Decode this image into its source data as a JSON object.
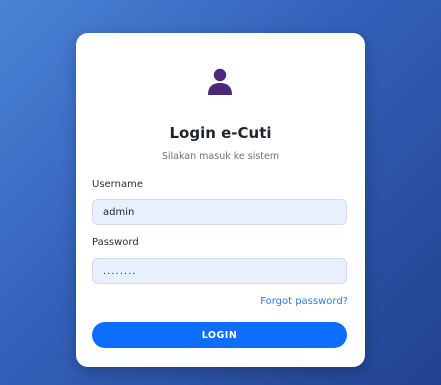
{
  "login": {
    "title": "Login e-Cuti",
    "subtitle": "Silakan masuk ke sistem",
    "username_label": "Username",
    "username_value": "admin",
    "password_label": "Password",
    "password_value": "........",
    "forgot_label": "Forgot password?",
    "button_label": "LOGIN"
  },
  "icons": {
    "avatar": "user-icon"
  },
  "colors": {
    "accent": "#0d6efd",
    "link": "#2f7de1",
    "avatar": "#4b2a7a",
    "input_bg": "#e8f0fe"
  }
}
